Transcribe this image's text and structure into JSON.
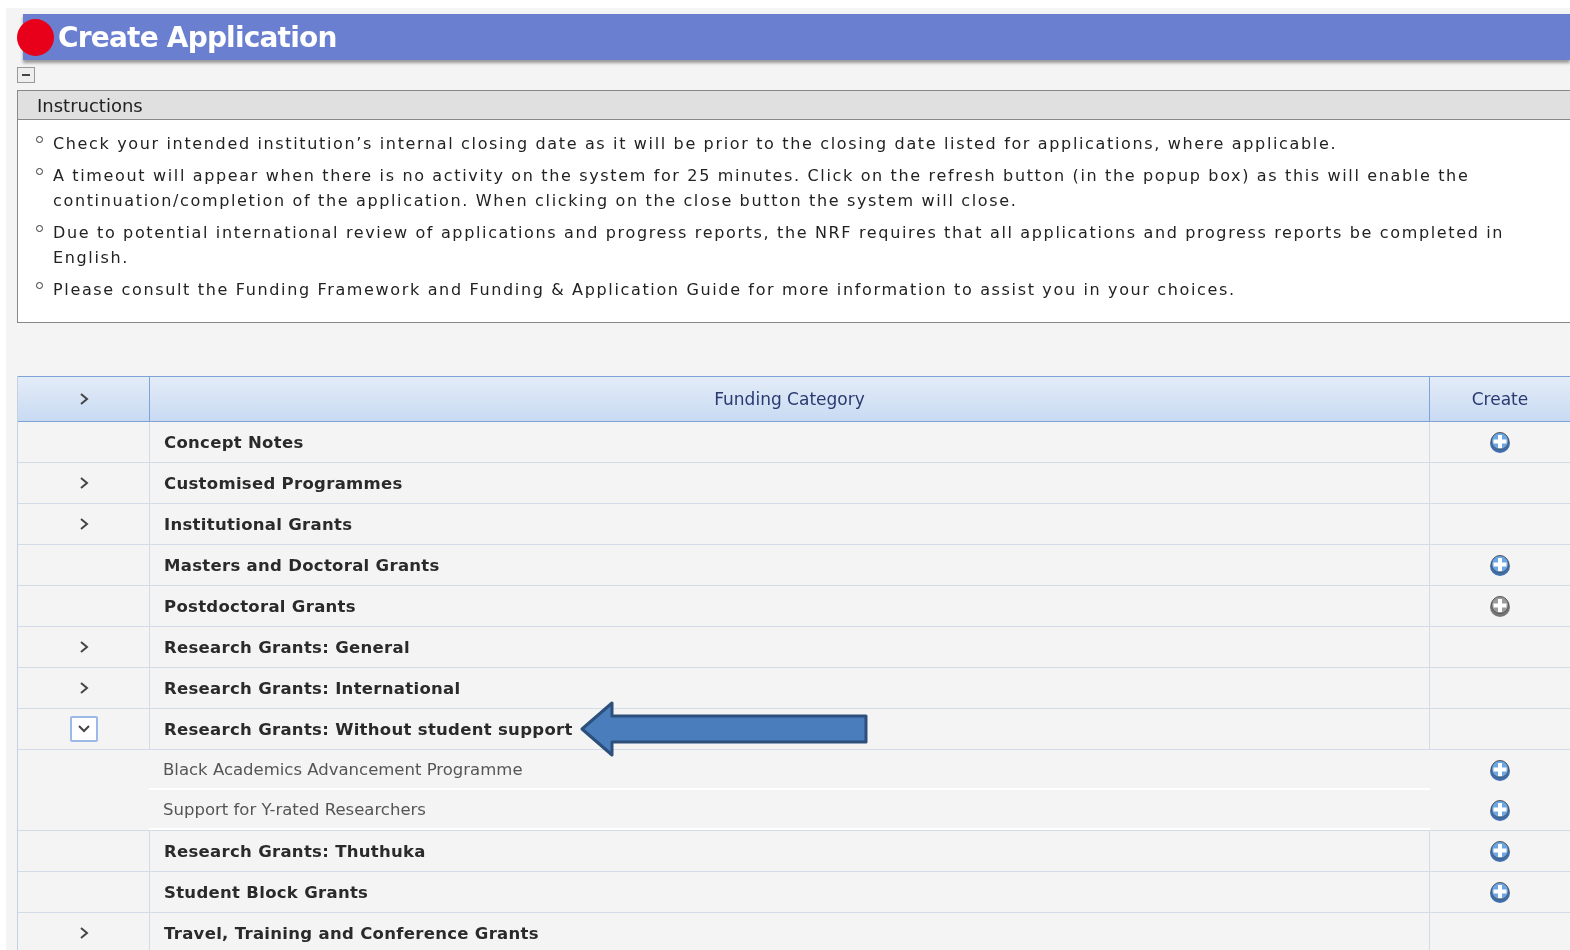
{
  "title": "Create Application",
  "instructions": {
    "heading": "Instructions",
    "collapsed": false,
    "items": [
      "Check your intended institution’s internal closing date as it will be prior to the closing date listed for applications, where applicable.",
      "A timeout will appear when there is no activity on the system for 25 minutes. Click on the refresh button (in the popup box) as this will enable the continuation/completion of the application. When clicking on the close button the system will close.",
      "Due to potential international review of applications and progress reports, the NRF requires that all applications and progress reports be completed in English.",
      "Please consult the Funding Framework and Funding & Application Guide for more information to assist you in your choices."
    ]
  },
  "table": {
    "columns": [
      "Funding Category",
      "Create"
    ],
    "rows": [
      {
        "name": "Concept Notes",
        "expandable": false,
        "expanded": false,
        "create": {
          "disabled": false
        }
      },
      {
        "name": "Customised Programmes",
        "expandable": true,
        "expanded": false
      },
      {
        "name": "Institutional Grants",
        "expandable": true,
        "expanded": false
      },
      {
        "name": "Masters and Doctoral Grants",
        "expandable": false,
        "expanded": false,
        "create": {
          "disabled": false
        }
      },
      {
        "name": "Postdoctoral Grants",
        "expandable": false,
        "expanded": false,
        "create": {
          "disabled": true
        }
      },
      {
        "name": "Research Grants: General",
        "expandable": true,
        "expanded": false
      },
      {
        "name": "Research Grants: International",
        "expandable": true,
        "expanded": false
      },
      {
        "name": "Research Grants: Without student support",
        "expandable": true,
        "expanded": true,
        "children": [
          {
            "name": "Black Academics Advancement Programme",
            "create": {
              "disabled": false
            }
          },
          {
            "name": "Support for Y-rated Researchers",
            "create": {
              "disabled": false
            }
          }
        ]
      },
      {
        "name": "Research Grants: Thuthuka",
        "expandable": false,
        "expanded": false,
        "create": {
          "disabled": false
        }
      },
      {
        "name": "Student Block Grants",
        "expandable": false,
        "expanded": false,
        "create": {
          "disabled": false
        }
      },
      {
        "name": "Travel, Training and Conference Grants",
        "expandable": true,
        "expanded": false
      }
    ]
  }
}
